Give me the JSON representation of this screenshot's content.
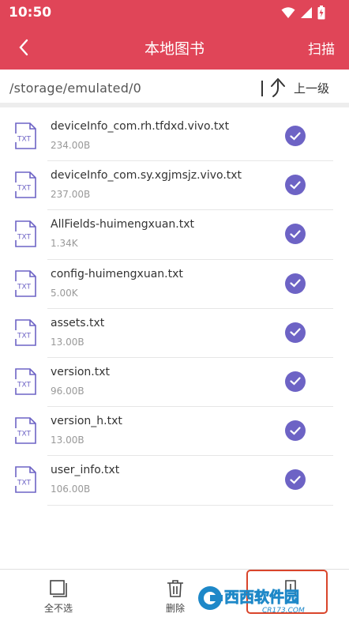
{
  "status_bar": {
    "time": "10:50"
  },
  "toolbar": {
    "title": "本地图书",
    "scan_label": "扫描"
  },
  "path_bar": {
    "path": "/storage/emulated/0",
    "up_label": "上一级"
  },
  "files": [
    {
      "name": "deviceInfo_com.rh.tfdxd.vivo.txt",
      "size": "234.00B",
      "icon_text": "TXT",
      "selected": true
    },
    {
      "name": "deviceInfo_com.sy.xgjmsjz.vivo.txt",
      "size": "237.00B",
      "icon_text": "TXT",
      "selected": true
    },
    {
      "name": "AllFields-huimengxuan.txt",
      "size": "1.34K",
      "icon_text": "TXT",
      "selected": true
    },
    {
      "name": "config-huimengxuan.txt",
      "size": "5.00K",
      "icon_text": "TXT",
      "selected": true
    },
    {
      "name": "assets.txt",
      "size": "13.00B",
      "icon_text": "TXT",
      "selected": true
    },
    {
      "name": "version.txt",
      "size": "96.00B",
      "icon_text": "TXT",
      "selected": true
    },
    {
      "name": "version_h.txt",
      "size": "13.00B",
      "icon_text": "TXT",
      "selected": true
    },
    {
      "name": "user_info.txt",
      "size": "106.00B",
      "icon_text": "TXT",
      "selected": true
    }
  ],
  "bottom_bar": {
    "deselect_all_label": "全不选",
    "delete_label": "删除"
  },
  "watermark": {
    "brand": "西西软件园",
    "site": "CR173.COM"
  },
  "colors": {
    "accent": "#e04558",
    "check": "#6d63c5",
    "icon": "#6d63c5"
  }
}
